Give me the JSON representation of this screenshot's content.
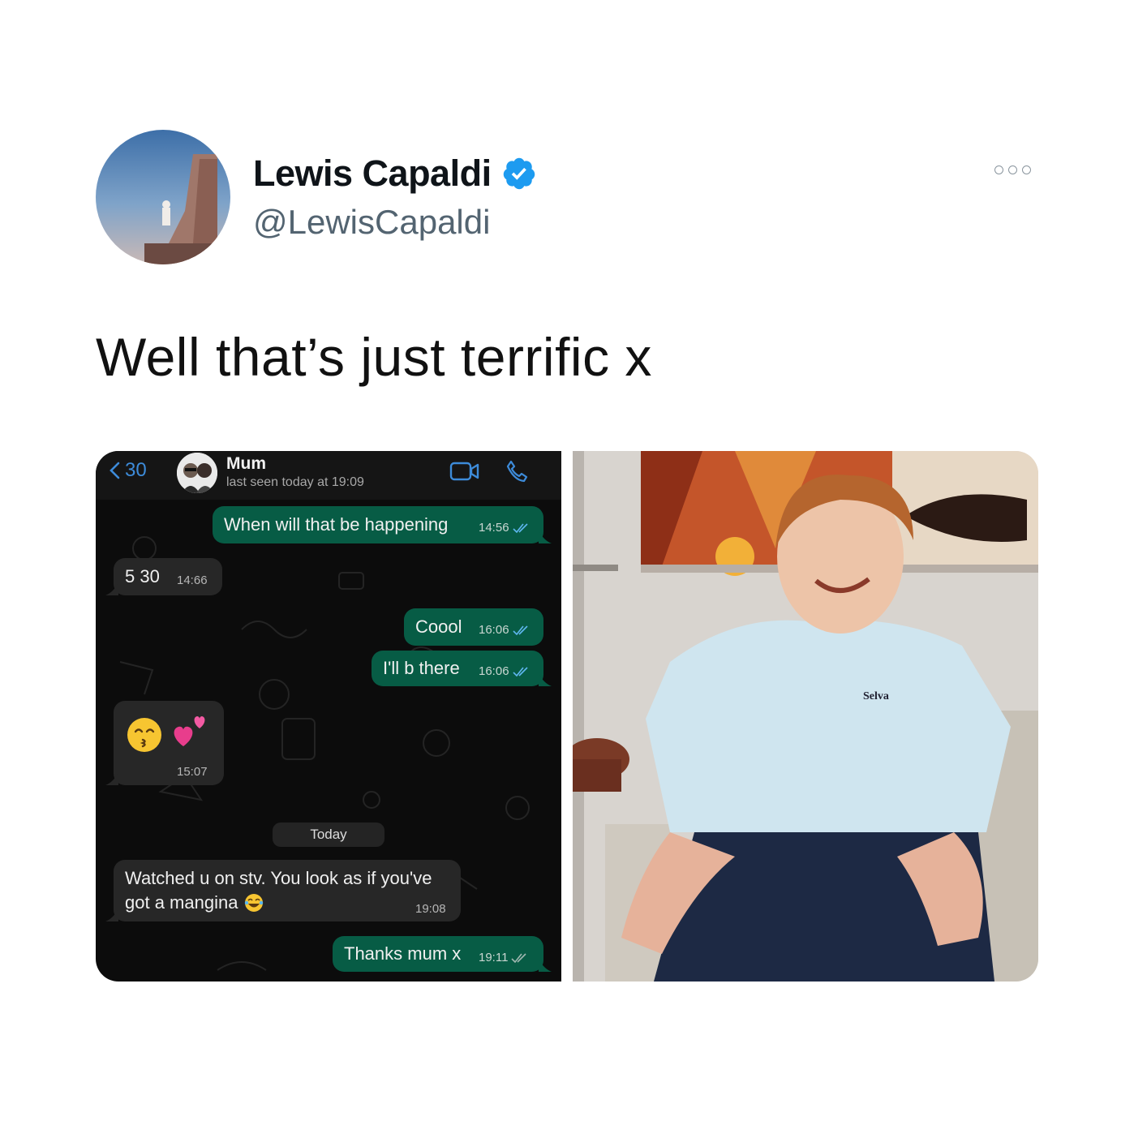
{
  "tweet": {
    "display_name": "Lewis Capaldi",
    "handle": "@LewisCapaldi",
    "text": "Well that’s just terrific x",
    "verified": true,
    "accent_color": "#1d9bf0"
  },
  "chat": {
    "back_count": "30",
    "contact_name": "Mum",
    "contact_status": "last seen today at 19:09",
    "date_divider": "Today",
    "messages": [
      {
        "direction": "outgoing",
        "text": "When will that be happening",
        "time": "14:56"
      },
      {
        "direction": "incoming",
        "text": "5 30",
        "time": "14:66"
      },
      {
        "direction": "outgoing",
        "text": "Coool",
        "time": "16:06"
      },
      {
        "direction": "outgoing",
        "text": "I'll b there",
        "time": "16:06"
      },
      {
        "direction": "incoming",
        "emoji": [
          "kissing-face-smiling-eyes",
          "two-hearts"
        ],
        "time": "15:07"
      },
      {
        "direction": "incoming",
        "line1": "Watched u on stv. You look as if you've",
        "line2": "got a mangina",
        "emoji": "face-with-tears-of-joy",
        "time": "19:08"
      },
      {
        "direction": "outgoing",
        "text": "Thanks mum x",
        "time": "19:11"
      }
    ],
    "colors": {
      "outgoing_bubble": "#075c45",
      "incoming_bubble": "#272727",
      "link_blue": "#3d8bd9"
    }
  },
  "photo": {
    "shirt_text": "Selva"
  }
}
